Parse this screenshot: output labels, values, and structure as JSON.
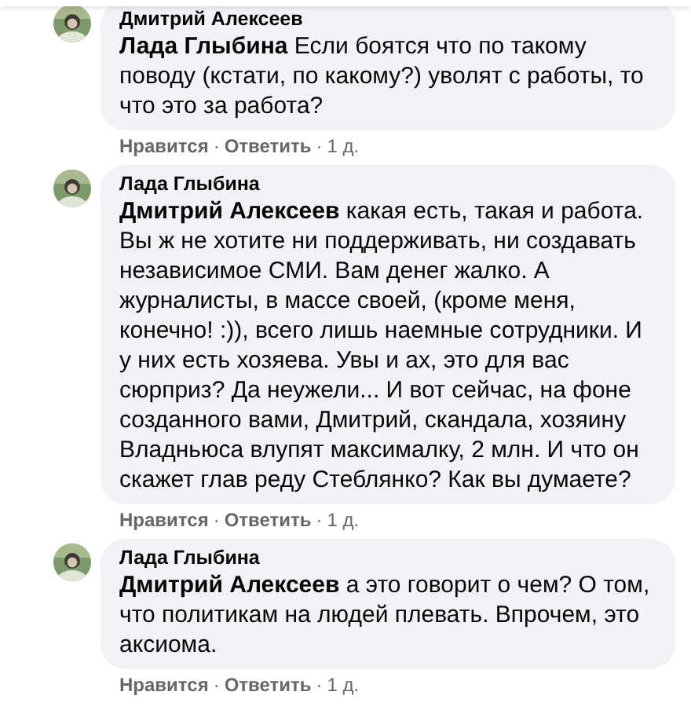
{
  "comments": [
    {
      "author": "Дмитрий Алексеев",
      "text": "**Лада Глыбина** Если боятся что по такому поводу (кстати, по какому?) уволят с работы, то что это за работа?",
      "actions": {
        "like": "Нравится",
        "separator": "·",
        "reply": "Ответить",
        "time": "1 д."
      }
    },
    {
      "author": "Лада Глыбина",
      "text": "**Дмитрий Алексеев** какая есть, такая и работа. Вы ж не хотите ни поддерживать, ни создавать независимое СМИ. Вам денег жалко. А журналисты, в массе своей, (кроме меня, конечно! :)), всего лишь наемные сотрудники. И у них есть хозяева. Увы и ах, это для вас сюрприз? Да неужели... И вот сейчас, на фоне созданного вами, Дмитрий, скандала, хозяину Владньюса влупят максималку, 2 млн. И что он скажет глав реду Стеблянко? Как вы думаете?",
      "actions": {
        "like": "Нравится",
        "separator": "·",
        "reply": "Ответить",
        "time": "1 д."
      }
    },
    {
      "author": "Лада Глыбина",
      "text": "**Дмитрий Алексеев** а это говорит о чем? О том, что политикам на людей плевать. Впрочем, это аксиома.",
      "actions": {
        "like": "Нравится",
        "separator": "·",
        "reply": "Ответить",
        "time": "1 д."
      }
    }
  ]
}
